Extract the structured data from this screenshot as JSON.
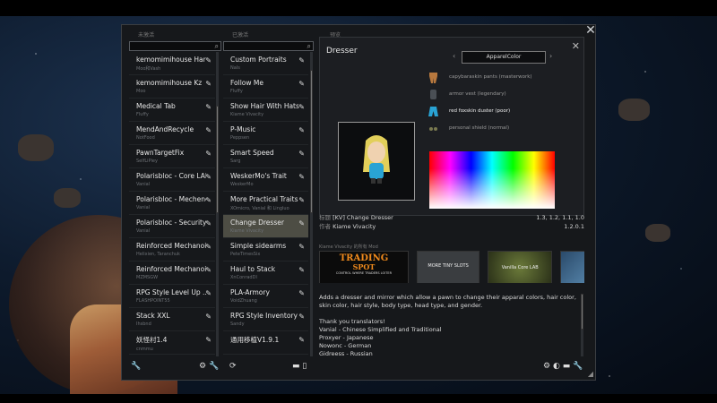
{
  "columns": {
    "left_header": "未激活",
    "mid_header": "已激活",
    "right_header": "预览"
  },
  "left_list": [
    {
      "name": "kemomimihouse Hard...",
      "author": "Moo和Vash"
    },
    {
      "name": "kemomimihouse Kz",
      "author": "Moo"
    },
    {
      "name": "Medical Tab",
      "author": "Fluffy"
    },
    {
      "name": "MendAndRecycle",
      "author": "NotFood"
    },
    {
      "name": "PawnTargetFix",
      "author": "SelfLiPiey"
    },
    {
      "name": "Polarisbloc - Core LAB",
      "author": "Vanial"
    },
    {
      "name": "Polarisbloc - Mechene...",
      "author": "Vanial"
    },
    {
      "name": "Polarisbloc - Security ...",
      "author": "Vanial"
    },
    {
      "name": "Reinforced Mechanoi...",
      "author": "Helixien, Taranchuk"
    },
    {
      "name": "Reinforced Mechanoi...",
      "author": "MZMSGW"
    },
    {
      "name": "RPG Style Level Up ...",
      "author": "FLASHPOINT55"
    },
    {
      "name": "Stack XXL",
      "author": "Ihsbnd"
    },
    {
      "name": "妖怪村1.4",
      "author": "cnmmu"
    }
  ],
  "mid_list": [
    {
      "name": "Custom Portraits",
      "author": "Nals"
    },
    {
      "name": "Follow Me",
      "author": "Fluffy"
    },
    {
      "name": "Show Hair With Hats ...",
      "author": "Kiame Vivacity"
    },
    {
      "name": "P-Music",
      "author": "Peppsen"
    },
    {
      "name": "Smart Speed",
      "author": "Sarg"
    },
    {
      "name": "WeskerMo's Trait",
      "author": "WeskerMo"
    },
    {
      "name": "More Practical Traits",
      "author": "XOmicro, Vanial 和 Lingluo"
    },
    {
      "name": "Change Dresser",
      "author": "Kiame Vivacity"
    },
    {
      "name": "Simple sidearms",
      "author": "PeteTimesSix"
    },
    {
      "name": "Haul to Stack",
      "author": "XnConradDl"
    },
    {
      "name": "PLA-Armory",
      "author": "VoidZhuang"
    },
    {
      "name": "RPG Style Inventory ...",
      "author": "Sandy"
    },
    {
      "name": "通用移植V1.9.1",
      "author": ""
    }
  ],
  "dresser": {
    "title": "Dresser",
    "tab": "ApparelColor",
    "apparel": [
      "capybaraskin pants (masterwork)",
      "armor vest (legendary)",
      "red foxskin duster (poor)",
      "personal shield (normal)"
    ]
  },
  "meta": {
    "title_label": "标题",
    "title_value": "[KV] Change Dresser",
    "versions": "1.3, 1.2, 1.1, 1.0",
    "author_label": "作者",
    "author_value": "Kiame Vivacity",
    "mod_version": "1.2.0.1"
  },
  "gallery": {
    "header": "Kiame Vivacity 的所有 Mod",
    "trading_title": "TRADING",
    "trading_sub": "SPOT",
    "trading_tag": "CONTROL WHERE TRADERS LOITER",
    "more_tiny": "MORE TINY SLOTS",
    "vanilla": "Vanilla Core LAB"
  },
  "description": {
    "p1": "Adds a dresser and mirror which allow a pawn to change their apparal colors, hair color, skin color, hair style, body type, head type, and gender.",
    "p2": "Thank you translators!",
    "t1": "Vanial - Chinese Simplified and Traditional",
    "t2": "Proxyer - Japanese",
    "t3": "Nowonc - German",
    "t4": "Gidreess - Russian"
  },
  "colors": {
    "window_bg": "#16181b",
    "selected_row": "#4d4d44",
    "accent_blue": "#29a3d4"
  }
}
